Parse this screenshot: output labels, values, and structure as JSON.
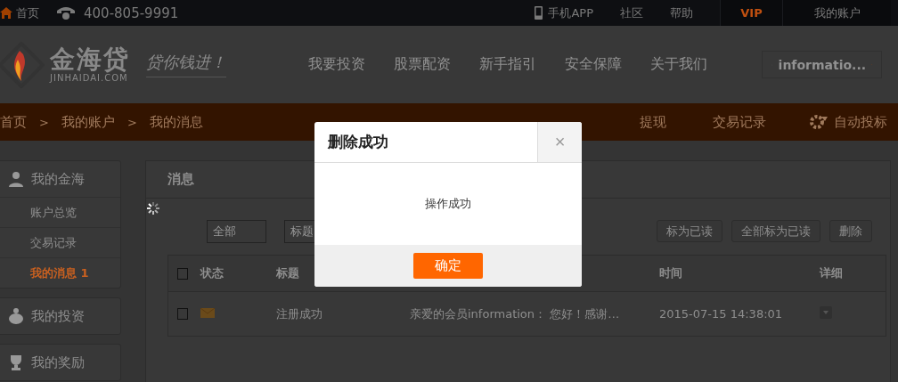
{
  "top_bar": {
    "home": "首页",
    "phone": "400-805-9991",
    "links": [
      {
        "kind": "app",
        "label": "手机APP"
      },
      {
        "kind": "plain",
        "label": "社区"
      },
      {
        "kind": "plain",
        "label": "帮助"
      },
      {
        "kind": "vip",
        "label": "VIP"
      },
      {
        "kind": "account",
        "label": "我的账户"
      }
    ]
  },
  "header": {
    "logo_name": "金海贷",
    "logo_domain": "JINHAIDAI.COM",
    "slogan": "贷你钱进！",
    "nav": [
      "我要投资",
      "股票配资",
      "新手指引",
      "安全保障",
      "关于我们"
    ],
    "user": "informatio..."
  },
  "breadcrumb": {
    "items": [
      {
        "kind": "link",
        "label": "首页"
      },
      {
        "kind": "sep",
        "label": ">"
      },
      {
        "kind": "link",
        "label": "我的账户"
      },
      {
        "kind": "sep",
        "label": ">"
      },
      {
        "kind": "link",
        "label": "我的消息"
      }
    ],
    "actions": [
      {
        "kind": "plain",
        "label": "提现"
      },
      {
        "kind": "plain",
        "label": "交易记录"
      },
      {
        "kind": "auto",
        "label": "自动投标"
      }
    ]
  },
  "sidebar": [
    {
      "kind": "user",
      "title": "我的金海",
      "items": [
        {
          "label": "账户总览",
          "selected": false
        },
        {
          "label": "交易记录",
          "selected": false
        },
        {
          "label": "我的消息",
          "count": "1",
          "selected": true
        }
      ]
    },
    {
      "kind": "piggy",
      "title": "我的投资"
    },
    {
      "kind": "trophy",
      "title": "我的奖励"
    }
  ],
  "messages": {
    "title": "消息",
    "type_select": "全部",
    "field_select": "标题",
    "buttons": [
      "标为已读",
      "全部标为已读",
      "删除"
    ],
    "header_checked": false,
    "columns": [
      "状态",
      "标题",
      "时间",
      "详细"
    ],
    "rows": [
      {
        "checked": false,
        "title": "注册成功",
        "content": "亲爱的会员information： 您好！感谢…",
        "time": "2015-07-15 14:38:01"
      }
    ]
  },
  "dialog": {
    "title": "删除成功",
    "close": "×",
    "message": "操作成功",
    "confirm": "确定"
  }
}
